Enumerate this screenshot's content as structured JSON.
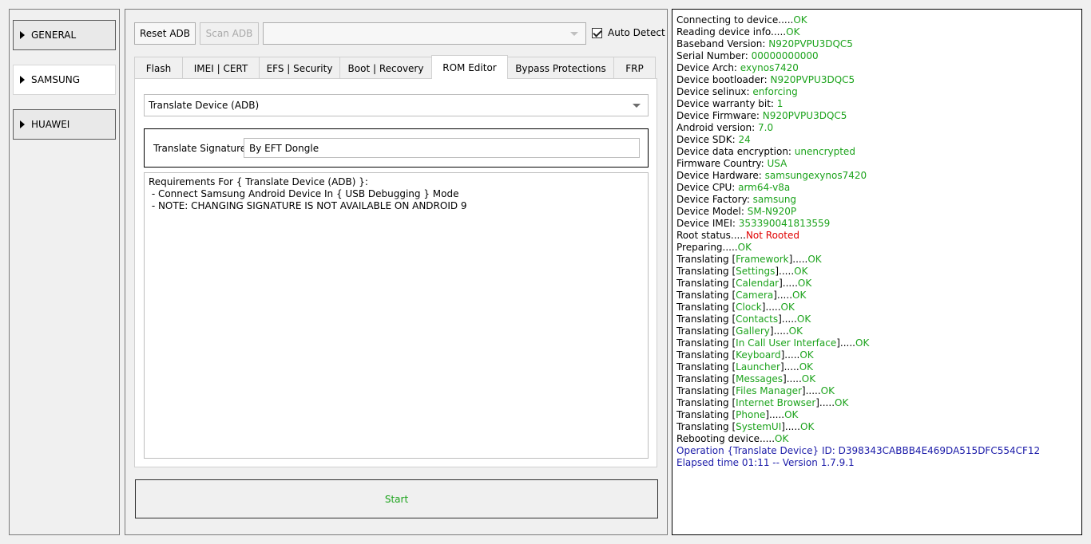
{
  "sidebar": {
    "items": [
      {
        "label": "GENERAL",
        "active": false
      },
      {
        "label": "SAMSUNG",
        "active": true
      },
      {
        "label": "HUAWEI",
        "active": false
      }
    ]
  },
  "toolbar": {
    "reset_label": "Reset ADB",
    "scan_label": "Scan ADB",
    "port_value": "",
    "auto_detect_label": "Auto Detect",
    "auto_detect_checked": true
  },
  "tabs": [
    {
      "label": "Flash"
    },
    {
      "label": "IMEI | CERT"
    },
    {
      "label": "EFS | Security"
    },
    {
      "label": "Boot | Recovery"
    },
    {
      "label": "ROM Editor",
      "active": true
    },
    {
      "label": "Bypass Protections"
    },
    {
      "label": "FRP"
    }
  ],
  "rom_editor": {
    "operation_value": "Translate Device (ADB)",
    "signature_label": "Translate Signature:",
    "signature_value": "By EFT Dongle",
    "requirements": "Requirements For { Translate Device (ADB) }:\n - Connect Samsung Android Device In { USB Debugging } Mode\n - NOTE: CHANGING SIGNATURE IS NOT AVAILABLE ON ANDROID 9"
  },
  "start_label": "Start",
  "colors": {
    "ok": "#1ca31c",
    "error": "#e00000",
    "info": "#1a1aa8"
  },
  "log": [
    [
      {
        "t": "Connecting to device....."
      },
      {
        "t": "OK",
        "c": "g"
      }
    ],
    [
      {
        "t": "Reading device info....."
      },
      {
        "t": "OK",
        "c": "g"
      }
    ],
    [
      {
        "t": "Baseband Version: "
      },
      {
        "t": "N920PVPU3DQC5",
        "c": "g"
      }
    ],
    [
      {
        "t": "Serial Number: "
      },
      {
        "t": "00000000000",
        "c": "g"
      }
    ],
    [
      {
        "t": "Device Arch: "
      },
      {
        "t": "exynos7420",
        "c": "g"
      }
    ],
    [
      {
        "t": "Device bootloader: "
      },
      {
        "t": "N920PVPU3DQC5",
        "c": "g"
      }
    ],
    [
      {
        "t": "Device selinux: "
      },
      {
        "t": "enforcing",
        "c": "g"
      }
    ],
    [
      {
        "t": "Device warranty bit: "
      },
      {
        "t": "1",
        "c": "g"
      }
    ],
    [
      {
        "t": "Device Firmware: "
      },
      {
        "t": "N920PVPU3DQC5",
        "c": "g"
      }
    ],
    [
      {
        "t": "Android version: "
      },
      {
        "t": "7.0",
        "c": "g"
      }
    ],
    [
      {
        "t": "Device SDK: "
      },
      {
        "t": "24",
        "c": "g"
      }
    ],
    [
      {
        "t": "Device data encryption: "
      },
      {
        "t": "unencrypted",
        "c": "g"
      }
    ],
    [
      {
        "t": "Firmware Country: "
      },
      {
        "t": "USA",
        "c": "g"
      }
    ],
    [
      {
        "t": "Device Hardware: "
      },
      {
        "t": "samsungexynos7420",
        "c": "g"
      }
    ],
    [
      {
        "t": "Device CPU: "
      },
      {
        "t": "arm64-v8a",
        "c": "g"
      }
    ],
    [
      {
        "t": "Device Factory: "
      },
      {
        "t": "samsung",
        "c": "g"
      }
    ],
    [
      {
        "t": "Device Model: "
      },
      {
        "t": "SM-N920P",
        "c": "g"
      }
    ],
    [
      {
        "t": "Device IMEI: "
      },
      {
        "t": "353390041813559",
        "c": "g"
      }
    ],
    [
      {
        "t": "Root status....."
      },
      {
        "t": "Not Rooted",
        "c": "r"
      }
    ],
    [
      {
        "t": "Preparing....."
      },
      {
        "t": "OK",
        "c": "g"
      }
    ],
    [
      {
        "t": "Translating ["
      },
      {
        "t": "Framework",
        "c": "g"
      },
      {
        "t": "]....."
      },
      {
        "t": "OK",
        "c": "g"
      }
    ],
    [
      {
        "t": "Translating ["
      },
      {
        "t": "Settings",
        "c": "g"
      },
      {
        "t": "]....."
      },
      {
        "t": "OK",
        "c": "g"
      }
    ],
    [
      {
        "t": "Translating ["
      },
      {
        "t": "Calendar",
        "c": "g"
      },
      {
        "t": "]....."
      },
      {
        "t": "OK",
        "c": "g"
      }
    ],
    [
      {
        "t": "Translating ["
      },
      {
        "t": "Camera",
        "c": "g"
      },
      {
        "t": "]....."
      },
      {
        "t": "OK",
        "c": "g"
      }
    ],
    [
      {
        "t": "Translating ["
      },
      {
        "t": "Clock",
        "c": "g"
      },
      {
        "t": "]....."
      },
      {
        "t": "OK",
        "c": "g"
      }
    ],
    [
      {
        "t": "Translating ["
      },
      {
        "t": "Contacts",
        "c": "g"
      },
      {
        "t": "]....."
      },
      {
        "t": "OK",
        "c": "g"
      }
    ],
    [
      {
        "t": "Translating ["
      },
      {
        "t": "Gallery",
        "c": "g"
      },
      {
        "t": "]....."
      },
      {
        "t": "OK",
        "c": "g"
      }
    ],
    [
      {
        "t": "Translating ["
      },
      {
        "t": "In Call User Interface",
        "c": "g"
      },
      {
        "t": "]....."
      },
      {
        "t": "OK",
        "c": "g"
      }
    ],
    [
      {
        "t": "Translating ["
      },
      {
        "t": "Keyboard",
        "c": "g"
      },
      {
        "t": "]....."
      },
      {
        "t": "OK",
        "c": "g"
      }
    ],
    [
      {
        "t": "Translating ["
      },
      {
        "t": "Launcher",
        "c": "g"
      },
      {
        "t": "]....."
      },
      {
        "t": "OK",
        "c": "g"
      }
    ],
    [
      {
        "t": "Translating ["
      },
      {
        "t": "Messages",
        "c": "g"
      },
      {
        "t": "]....."
      },
      {
        "t": "OK",
        "c": "g"
      }
    ],
    [
      {
        "t": "Translating ["
      },
      {
        "t": "Files Manager",
        "c": "g"
      },
      {
        "t": "]....."
      },
      {
        "t": "OK",
        "c": "g"
      }
    ],
    [
      {
        "t": "Translating ["
      },
      {
        "t": "Internet Browser",
        "c": "g"
      },
      {
        "t": "]....."
      },
      {
        "t": "OK",
        "c": "g"
      }
    ],
    [
      {
        "t": "Translating ["
      },
      {
        "t": "Phone",
        "c": "g"
      },
      {
        "t": "]....."
      },
      {
        "t": "OK",
        "c": "g"
      }
    ],
    [
      {
        "t": "Translating ["
      },
      {
        "t": "SystemUI",
        "c": "g"
      },
      {
        "t": "]....."
      },
      {
        "t": "OK",
        "c": "g"
      }
    ],
    [
      {
        "t": "Rebooting device....."
      },
      {
        "t": "OK",
        "c": "g"
      }
    ],
    [
      {
        "t": "Operation {Translate Device} ID: D398343CABBB4E469DA515DFC554CF12",
        "c": "b"
      }
    ],
    [
      {
        "t": "Elapsed time 01:11  -- Version 1.7.9.1",
        "c": "b"
      }
    ]
  ]
}
